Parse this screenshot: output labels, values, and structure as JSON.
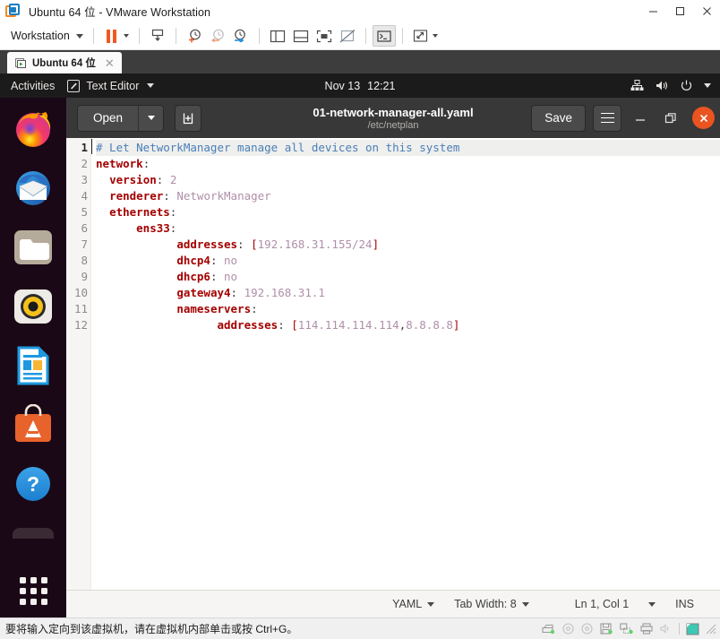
{
  "vmware": {
    "title": "Ubuntu 64 位 - VMware Workstation",
    "logo_icon": "vmware-logo-icon",
    "window_controls": {
      "minimize": "minimize-icon",
      "maximize": "maximize-icon",
      "close": "close-icon"
    },
    "toolbar": {
      "menu_label": "Workstation",
      "items": [
        {
          "name": "pause-button",
          "icon": "pause-icon"
        },
        {
          "name": "pause-dropdown",
          "icon": "chevron-down-icon"
        },
        {
          "name": "send-ctrl-alt-del-button",
          "icon": "send-key-icon"
        },
        {
          "name": "take-snapshot-button",
          "icon": "snapshot-add-icon"
        },
        {
          "name": "revert-snapshot-button",
          "icon": "snapshot-revert-icon"
        },
        {
          "name": "manage-snapshots-button",
          "icon": "snapshot-manage-icon"
        },
        {
          "name": "show-sidebar-button",
          "icon": "panel-left-icon"
        },
        {
          "name": "show-thumbnail-bar-button",
          "icon": "panel-bottom-icon"
        },
        {
          "name": "show-console-view-button",
          "icon": "fullscreen-icon"
        },
        {
          "name": "hide-console-view-button",
          "icon": "panel-hidden-icon"
        },
        {
          "name": "unity-mode-button",
          "icon": "terminal-icon"
        },
        {
          "name": "fullscreen-button",
          "icon": "expand-arrows-icon"
        },
        {
          "name": "fullscreen-dropdown",
          "icon": "chevron-down-icon"
        }
      ]
    },
    "tab": {
      "label": "Ubuntu 64 位",
      "icon": "vm-running-icon",
      "close_icon": "close-icon"
    },
    "status": {
      "message": "要将输入定向到该虚拟机，请在虚拟机内部单击或按 Ctrl+G。",
      "icons": [
        "hard-disk-icon",
        "cd-drive-icon",
        "cd-drive-2-icon",
        "floppy-icon",
        "network-adapter-icon",
        "printer-icon",
        "sound-muted-icon",
        "display-icon"
      ],
      "resize_grip_icon": "resize-grip-icon"
    }
  },
  "ubuntu": {
    "panel": {
      "activities": "Activities",
      "app_name": "Text Editor",
      "app_icon": "text-editor-icon",
      "app_caret_icon": "chevron-down-icon",
      "clock_date": "Nov 13",
      "clock_time": "12:21",
      "indicators": [
        {
          "name": "network-indicator",
          "icon": "network-wired-icon"
        },
        {
          "name": "volume-indicator",
          "icon": "volume-icon"
        },
        {
          "name": "power-indicator",
          "icon": "power-icon"
        },
        {
          "name": "system-menu-caret",
          "icon": "chevron-down-icon"
        }
      ]
    },
    "dock": {
      "items": [
        {
          "name": "dock-item-firefox",
          "icon": "firefox-icon",
          "label": "Firefox"
        },
        {
          "name": "dock-item-thunderbird",
          "icon": "thunderbird-icon",
          "label": "Thunderbird Mail"
        },
        {
          "name": "dock-item-files",
          "icon": "files-icon",
          "label": "Files"
        },
        {
          "name": "dock-item-rhythmbox",
          "icon": "rhythmbox-icon",
          "label": "Rhythmbox"
        },
        {
          "name": "dock-item-libreoffice-writer",
          "icon": "libreoffice-writer-icon",
          "label": "LibreOffice Writer"
        },
        {
          "name": "dock-item-ubuntu-software",
          "icon": "ubuntu-software-icon",
          "label": "Ubuntu Software"
        },
        {
          "name": "dock-item-help",
          "icon": "help-icon",
          "label": "Help"
        }
      ],
      "show_apps": {
        "name": "show-applications-button",
        "icon": "grid-apps-icon"
      }
    }
  },
  "gedit": {
    "header": {
      "open_label": "Open",
      "open_caret_icon": "chevron-down-icon",
      "new_tab_icon": "new-document-icon",
      "title": "01-network-manager-all.yaml",
      "subtitle": "/etc/netplan",
      "save_label": "Save",
      "menu_icon": "hamburger-menu-icon",
      "minimize_icon": "minimize-icon",
      "restore_icon": "restore-icon",
      "close_icon": "close-icon"
    },
    "editor": {
      "line_numbers": [
        "1",
        "2",
        "3",
        "4",
        "5",
        "6",
        "7",
        "8",
        "9",
        "10",
        "11",
        "12"
      ],
      "current_line": 1,
      "lines": [
        {
          "n": 1,
          "tokens": [
            {
              "t": "# Let NetworkManager manage all devices on this system",
              "c": "cmt"
            }
          ]
        },
        {
          "n": 2,
          "tokens": [
            {
              "t": "network",
              "c": "key"
            },
            {
              "t": ":",
              "c": "pun"
            }
          ]
        },
        {
          "n": 3,
          "tokens": [
            {
              "t": "  ",
              "c": "pun"
            },
            {
              "t": "version",
              "c": "key"
            },
            {
              "t": ": ",
              "c": "pun"
            },
            {
              "t": "2",
              "c": "val"
            }
          ]
        },
        {
          "n": 4,
          "tokens": [
            {
              "t": "  ",
              "c": "pun"
            },
            {
              "t": "renderer",
              "c": "key"
            },
            {
              "t": ": ",
              "c": "pun"
            },
            {
              "t": "NetworkManager",
              "c": "val"
            }
          ]
        },
        {
          "n": 5,
          "tokens": [
            {
              "t": "  ",
              "c": "pun"
            },
            {
              "t": "ethernets",
              "c": "key"
            },
            {
              "t": ":",
              "c": "pun"
            }
          ]
        },
        {
          "n": 6,
          "tokens": [
            {
              "t": "      ",
              "c": "pun"
            },
            {
              "t": "ens33",
              "c": "key"
            },
            {
              "t": ":",
              "c": "pun"
            }
          ]
        },
        {
          "n": 7,
          "tokens": [
            {
              "t": "            ",
              "c": "pun"
            },
            {
              "t": "addresses",
              "c": "key"
            },
            {
              "t": ": ",
              "c": "pun"
            },
            {
              "t": "[",
              "c": "brk"
            },
            {
              "t": "192.168.31.155/24",
              "c": "val"
            },
            {
              "t": "]",
              "c": "brk"
            }
          ]
        },
        {
          "n": 8,
          "tokens": [
            {
              "t": "            ",
              "c": "pun"
            },
            {
              "t": "dhcp4",
              "c": "key"
            },
            {
              "t": ": ",
              "c": "pun"
            },
            {
              "t": "no",
              "c": "val"
            }
          ]
        },
        {
          "n": 9,
          "tokens": [
            {
              "t": "            ",
              "c": "pun"
            },
            {
              "t": "dhcp6",
              "c": "key"
            },
            {
              "t": ": ",
              "c": "pun"
            },
            {
              "t": "no",
              "c": "val"
            }
          ]
        },
        {
          "n": 10,
          "tokens": [
            {
              "t": "            ",
              "c": "pun"
            },
            {
              "t": "gateway4",
              "c": "key"
            },
            {
              "t": ": ",
              "c": "pun"
            },
            {
              "t": "192.168.31.1",
              "c": "val"
            }
          ]
        },
        {
          "n": 11,
          "tokens": [
            {
              "t": "            ",
              "c": "pun"
            },
            {
              "t": "nameservers",
              "c": "key"
            },
            {
              "t": ":",
              "c": "pun"
            }
          ]
        },
        {
          "n": 12,
          "tokens": [
            {
              "t": "                  ",
              "c": "pun"
            },
            {
              "t": "addresses",
              "c": "key"
            },
            {
              "t": ": ",
              "c": "pun"
            },
            {
              "t": "[",
              "c": "brk"
            },
            {
              "t": "114.114.114.114",
              "c": "val"
            },
            {
              "t": ",",
              "c": "pun"
            },
            {
              "t": "8.8.8.8",
              "c": "val"
            },
            {
              "t": "]",
              "c": "brk"
            }
          ]
        }
      ],
      "plain_text": "# Let NetworkManager manage all devices on this system\nnetwork:\n  version: 2\n  renderer: NetworkManager\n  ethernets:\n      ens33:\n            addresses: [192.168.31.155/24]\n            dhcp4: no\n            dhcp6: no\n            gateway4: 192.168.31.1\n            nameservers:\n                  addresses: [114.114.114.114,8.8.8.8]"
    },
    "statusbar": {
      "language": "YAML",
      "tab_width": "Tab Width: 8",
      "position": "Ln 1, Col 1",
      "insert_mode": "INS",
      "language_caret_icon": "chevron-down-icon",
      "tabwidth_caret_icon": "chevron-down-icon",
      "position_caret_icon": "chevron-down-icon"
    }
  },
  "colors": {
    "ubuntu_orange": "#e95420",
    "vmware_orange": "#f05a22",
    "vmware_blue": "#1a7fc1",
    "gedit_header": "#383838",
    "dock_bg": "#170a15",
    "comment": "#4a7fb7",
    "keyword": "#a40000",
    "value": "#b08fa8",
    "current_line": "#efefee"
  }
}
